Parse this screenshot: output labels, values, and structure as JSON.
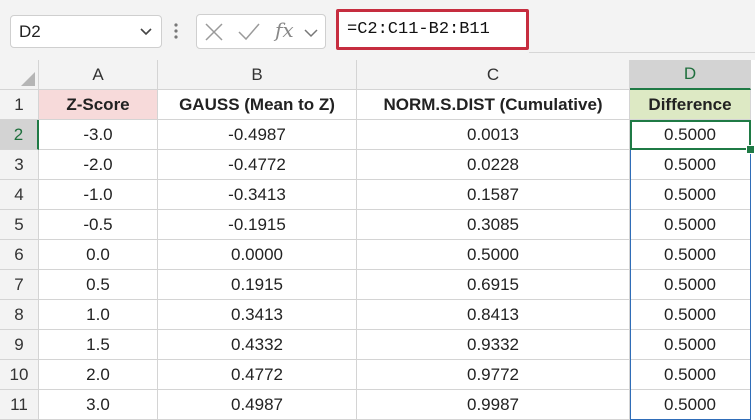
{
  "name_box": {
    "value": "D2"
  },
  "formula_bar": {
    "formula": "=C2:C11-B2:B11",
    "fx_label": "fx"
  },
  "columns": [
    "A",
    "B",
    "C",
    "D"
  ],
  "selected_column": "D",
  "selected_row": "2",
  "headers": {
    "row_label": "1",
    "cells": [
      "Z-Score",
      "GAUSS (Mean to Z)",
      "NORM.S.DIST (Cumulative)",
      "Difference"
    ]
  },
  "rows": [
    {
      "row": "2",
      "cells": [
        "-3.0",
        "-0.4987",
        "0.0013",
        "0.5000"
      ]
    },
    {
      "row": "3",
      "cells": [
        "-2.0",
        "-0.4772",
        "0.0228",
        "0.5000"
      ]
    },
    {
      "row": "4",
      "cells": [
        "-1.0",
        "-0.3413",
        "0.1587",
        "0.5000"
      ]
    },
    {
      "row": "5",
      "cells": [
        "-0.5",
        "-0.1915",
        "0.3085",
        "0.5000"
      ]
    },
    {
      "row": "6",
      "cells": [
        "0.0",
        "0.0000",
        "0.5000",
        "0.5000"
      ]
    },
    {
      "row": "7",
      "cells": [
        "0.5",
        "0.1915",
        "0.6915",
        "0.5000"
      ]
    },
    {
      "row": "8",
      "cells": [
        "1.0",
        "0.3413",
        "0.8413",
        "0.5000"
      ]
    },
    {
      "row": "9",
      "cells": [
        "1.5",
        "0.4332",
        "0.9332",
        "0.5000"
      ]
    },
    {
      "row": "10",
      "cells": [
        "2.0",
        "0.4772",
        "0.9772",
        "0.5000"
      ]
    },
    {
      "row": "11",
      "cells": [
        "3.0",
        "0.4987",
        "0.9987",
        "0.5000"
      ]
    }
  ],
  "colors": {
    "accent": "#1f7a45",
    "formula_highlight": "#c62d3f",
    "header_pink": "#f7dada",
    "header_green": "#dde9c4",
    "range_blue": "#2f6db8"
  }
}
